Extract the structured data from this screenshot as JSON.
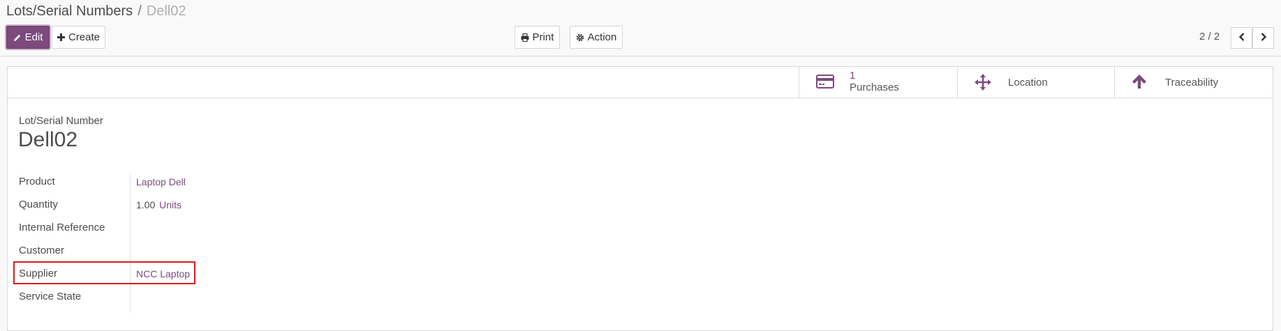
{
  "breadcrumb": {
    "parent": "Lots/Serial Numbers",
    "separator": "/",
    "current": "Dell02"
  },
  "toolbar": {
    "edit_label": "Edit",
    "create_label": "Create",
    "print_label": "Print",
    "action_label": "Action"
  },
  "pager": {
    "text": "2 / 2"
  },
  "smart_buttons": {
    "purchases_count": "1",
    "purchases_label": "Purchases",
    "location_label": "Location",
    "traceability_label": "Traceability"
  },
  "record": {
    "lot_label": "Lot/Serial Number",
    "lot_name": "Dell02",
    "fields": [
      {
        "label": "Product",
        "value": "Laptop Dell"
      },
      {
        "label": "Quantity",
        "value": "1.00",
        "unit": "Units"
      },
      {
        "label": "Internal Reference",
        "value": ""
      },
      {
        "label": "Customer",
        "value": ""
      },
      {
        "label": "Supplier",
        "value": "NCC Laptop"
      },
      {
        "label": "Service State",
        "value": ""
      }
    ]
  },
  "colors": {
    "brand": "#7c4a7d",
    "highlight": "#e0191f",
    "text": "#4c4c4c"
  }
}
